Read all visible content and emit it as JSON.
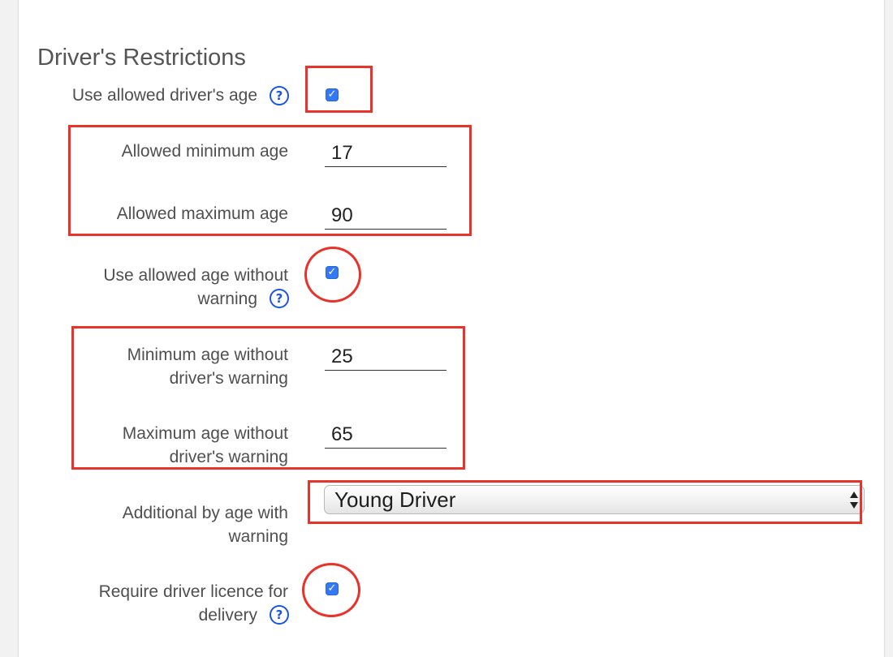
{
  "section": {
    "title": "Driver's Restrictions"
  },
  "fields": {
    "use_allowed_age": {
      "label": "Use allowed driver's age",
      "checked": true
    },
    "min_age": {
      "label": "Allowed minimum age",
      "value": "17"
    },
    "max_age": {
      "label": "Allowed maximum age",
      "value": "90"
    },
    "use_age_without_warning": {
      "label_line1": "Use allowed age without",
      "label_line2": "warning",
      "checked": true
    },
    "min_age_no_warning": {
      "label_line1": "Minimum age without",
      "label_line2": "driver's warning",
      "value": "25"
    },
    "max_age_no_warning": {
      "label_line1": "Maximum age without",
      "label_line2": "driver's warning",
      "value": "65"
    },
    "additional_by_age": {
      "label_line1": "Additional by age with",
      "label_line2": "warning",
      "selected": "Young Driver"
    },
    "require_licence": {
      "label_line1": "Require driver licence for",
      "label_line2": "delivery",
      "checked": true
    }
  },
  "icons": {
    "help": "help-circle-icon",
    "check": "checkmark-icon",
    "select_arrows": "up-down-arrows-icon"
  },
  "glyphs": {
    "help": "?",
    "check": "✓"
  },
  "colors": {
    "accent": "#1a56db",
    "checkbox": "#3478f6",
    "annotation": "#e8322a"
  }
}
